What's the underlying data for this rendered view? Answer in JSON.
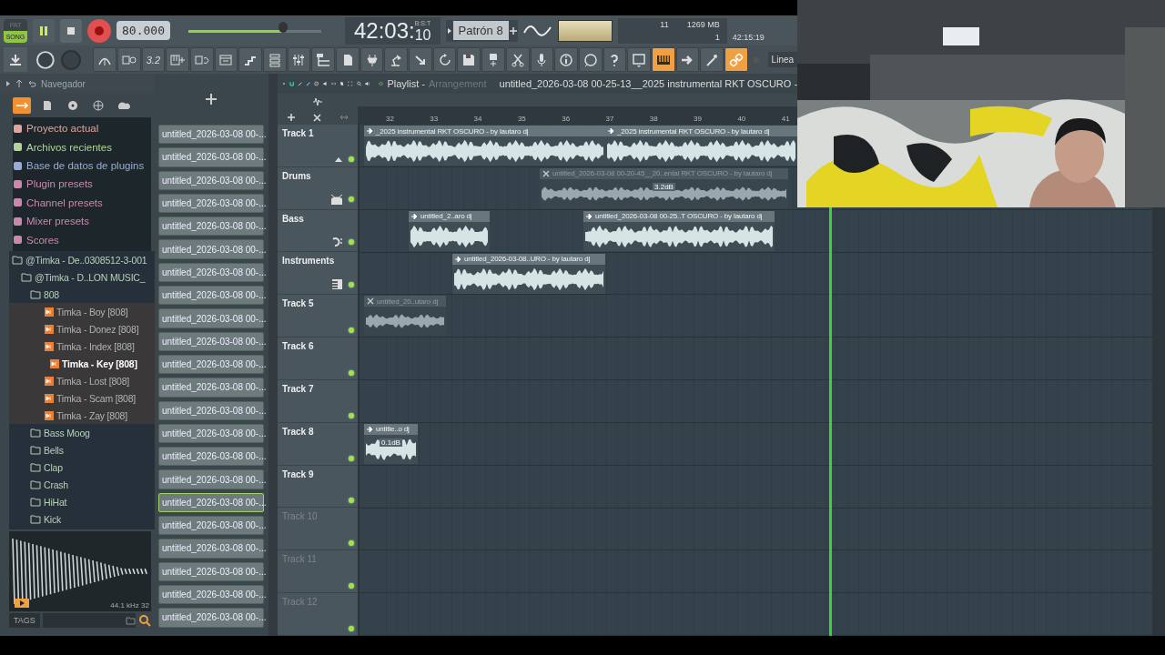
{
  "transport": {
    "modes": [
      {
        "label": "PAT",
        "selected": false
      },
      {
        "label": "SONG",
        "selected": true
      }
    ],
    "playing": true,
    "tempo": "80.000",
    "volume": {
      "level": 0.71
    },
    "time": "42:03:",
    "ticks": "10",
    "time_format": "B:S:T",
    "pattern": "Patrón 8",
    "cpu": "11",
    "memory": "1269 MB",
    "polyphony": "1",
    "clock": "42:15:19"
  },
  "toolbar": {
    "buttons": [
      {
        "on": false
      },
      {
        "on": false
      },
      {
        "label": "3.2",
        "on": false
      },
      {
        "on": false
      },
      {
        "on": false
      },
      {
        "on": false
      },
      {
        "on": false
      },
      {
        "on": false
      },
      {
        "on": false
      },
      {
        "on": false
      },
      {
        "on": false
      },
      {
        "on": false
      },
      {
        "on": false
      },
      {
        "on": false
      },
      {
        "on": false
      },
      {
        "on": false
      },
      {
        "on": false
      },
      {
        "on": false
      },
      {
        "on": false
      },
      {
        "on": false
      },
      {
        "on": false
      },
      {
        "on": false
      },
      {
        "on": false
      },
      {
        "on": true
      },
      {
        "on": false
      },
      {
        "on": false
      },
      {
        "on": true
      }
    ],
    "snap": "Linea"
  },
  "browser": {
    "title": "Navegador",
    "tabs": [
      {
        "selected": true
      },
      {
        "selected": false
      },
      {
        "selected": false
      },
      {
        "selected": false
      },
      {
        "selected": false
      }
    ],
    "categories": [
      {
        "label": "Proyecto actual",
        "color": "#e0a49c"
      },
      {
        "label": "Archivos recientes",
        "color": "#b4d49a"
      },
      {
        "label": "Base de datos de plugins",
        "color": "#98acd4"
      },
      {
        "label": "Plugin presets",
        "color": "#c889ad"
      },
      {
        "label": "Channel presets",
        "color": "#c889ad"
      },
      {
        "label": "Mixer presets",
        "color": "#c889ad"
      },
      {
        "label": "Scores",
        "color": "#c889ad"
      }
    ],
    "tree": [
      {
        "kind": "folder",
        "label": "@Timka - De..0308512-3-001",
        "selected": false,
        "children": [
          {
            "kind": "folder",
            "label": "@Timka - D..LON MUSIC_",
            "selected": false,
            "children": [
              {
                "kind": "folder",
                "label": "808",
                "selected": false,
                "children": [
                  {
                    "kind": "file",
                    "label": "Timka - Boy [808]",
                    "selected": false
                  },
                  {
                    "kind": "file",
                    "label": "Timka - Donez [808]",
                    "selected": false
                  },
                  {
                    "kind": "file",
                    "label": "Timka - Index [808]",
                    "selected": false
                  },
                  {
                    "kind": "file",
                    "label": "Timka - Key [808]",
                    "selected": true
                  },
                  {
                    "kind": "file",
                    "label": "Timka - Lost [808]",
                    "selected": false
                  },
                  {
                    "kind": "file",
                    "label": "Timka - Scam [808]",
                    "selected": false
                  },
                  {
                    "kind": "file",
                    "label": "Timka - Zay [808]",
                    "selected": false
                  }
                ]
              },
              {
                "kind": "folder",
                "label": "Bass Moog",
                "selected": false
              },
              {
                "kind": "folder",
                "label": "Bells",
                "selected": false
              },
              {
                "kind": "folder",
                "label": "Clap",
                "selected": false
              },
              {
                "kind": "folder",
                "label": "Crash",
                "selected": false
              },
              {
                "kind": "folder",
                "label": "HiHat",
                "selected": false
              },
              {
                "kind": "folder",
                "label": "Kick",
                "selected": false
              }
            ]
          }
        ]
      }
    ],
    "preview": {
      "info": "44.1 kHz 32"
    },
    "tags": "TAGS"
  },
  "patterns": [
    {
      "label": "untitled_2026-03-08 00-...",
      "selected": false
    },
    {
      "label": "untitled_2026-03-08 00-...",
      "selected": false
    },
    {
      "label": "untitled_2026-03-08 00-...",
      "selected": false
    },
    {
      "label": "untitled_2026-03-08 00-...",
      "selected": false
    },
    {
      "label": "untitled_2026-03-08 00-...",
      "selected": false
    },
    {
      "label": "untitled_2026-03-08 00-...",
      "selected": false
    },
    {
      "label": "untitled_2026-03-08 00-...",
      "selected": false
    },
    {
      "label": "untitled_2026-03-08 00-...",
      "selected": false
    },
    {
      "label": "untitled_2026-03-08 00-...",
      "selected": false
    },
    {
      "label": "untitled_2026-03-08 00-...",
      "selected": false
    },
    {
      "label": "untitled_2026-03-08 00-...",
      "selected": false
    },
    {
      "label": "untitled_2026-03-08 00-...",
      "selected": false
    },
    {
      "label": "untitled_2026-03-08 00-...",
      "selected": false
    },
    {
      "label": "untitled_2026-03-08 00-...",
      "selected": false
    },
    {
      "label": "untitled_2026-03-08 00-...",
      "selected": false
    },
    {
      "label": "untitled_2026-03-08 00-...",
      "selected": false
    },
    {
      "label": "untitled_2026-03-08 00-...",
      "selected": true
    },
    {
      "label": "untitled_2026-03-08 00-...",
      "selected": false
    },
    {
      "label": "untitled_2026-03-08 00-...",
      "selected": false
    },
    {
      "label": "untitled_2026-03-08 00-...",
      "selected": false
    },
    {
      "label": "untitled_2026-03-08 00-...",
      "selected": false
    },
    {
      "label": "untitled_2026-03-08 00-...",
      "selected": false
    }
  ],
  "playlist": {
    "title": "Playlist -",
    "subtitle": "Arrangement",
    "document": "untitled_2026-03-08 00-25-13__2025 instrumental RKT OSCURO -",
    "bars": [
      "32",
      "33",
      "34",
      "35",
      "36",
      "37",
      "38",
      "39",
      "40",
      "41"
    ],
    "tracks": [
      {
        "name": "Track 1",
        "dimmed": false,
        "clips": [
          {
            "title": "_2025 instrumental RKT OSCURO - by lautaro dj",
            "muted": false
          },
          {
            "title": "_2025 instrumental RKT OSCURO - by lautaro dj",
            "muted": false
          }
        ]
      },
      {
        "name": "Drums",
        "dimmed": false,
        "clips": [
          {
            "title": "untitled_2026-03-08 00-20-45__20..ental RKT OSCURO - by lautaro dj",
            "muted": true,
            "gain": "3.2dB"
          }
        ]
      },
      {
        "name": "Bass",
        "dimmed": false,
        "clips": [
          {
            "title": "untitled_2..aro dj",
            "muted": false
          },
          {
            "title": "untitled_2026-03-08 00-25..T OSCURO - by lautaro dj",
            "muted": false
          }
        ]
      },
      {
        "name": "Instruments",
        "dimmed": false,
        "clips": [
          {
            "title": "untitled_2026-03-08..URO - by lautaro dj",
            "muted": false
          }
        ]
      },
      {
        "name": "Track 5",
        "dimmed": false,
        "clips": [
          {
            "title": "untitled_20..utaro dj",
            "muted": true
          }
        ]
      },
      {
        "name": "Track 6",
        "dimmed": false
      },
      {
        "name": "Track 7",
        "dimmed": false
      },
      {
        "name": "Track 8",
        "dimmed": false,
        "clips": [
          {
            "title": "untitle..o dj",
            "muted": false,
            "gain": "0.1dB"
          }
        ]
      },
      {
        "name": "Track 9",
        "dimmed": false
      },
      {
        "name": "Track 10",
        "dimmed": true
      },
      {
        "name": "Track 11",
        "dimmed": true
      },
      {
        "name": "Track 12",
        "dimmed": true
      }
    ]
  }
}
